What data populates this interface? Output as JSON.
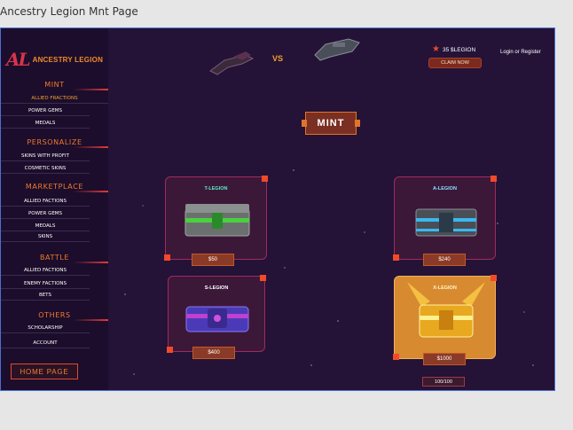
{
  "window": {
    "title": "Ancestry Legion Mnt Page"
  },
  "logo": {
    "mark": "AL",
    "text": "ANCESTRY LEGION"
  },
  "sidebar": {
    "sections": [
      {
        "title": "MINT",
        "items": [
          "ALLIED FRACTIONS",
          "POWER GEMS",
          "MEDALS"
        ]
      },
      {
        "title": "PERSONALIZE",
        "items": [
          "SKINS WITH PROFIT",
          "COSMETIC SKINS"
        ]
      },
      {
        "title": "MARKETPLACE",
        "items": [
          "ALLIED FACTIONS",
          "POWER GEMS",
          "MEDALS",
          "SKINS"
        ]
      },
      {
        "title": "BATTLE",
        "items": [
          "ALLIED FACTIONS",
          "ENEMY FACTIONS",
          "BETS"
        ]
      },
      {
        "title": "OTHERS",
        "items": [
          "SCHOLARSHIP",
          "ACCOUNT"
        ]
      }
    ],
    "home_button": "HOME PAGE"
  },
  "header": {
    "vs": "VS",
    "balance": "35 $LEGION",
    "claim_button": "CLAIM NOW",
    "login": "Login or Register"
  },
  "mint_banner": "MINT",
  "cards": [
    {
      "name": "T-LEGION",
      "price": "$50"
    },
    {
      "name": "A-LEGION",
      "price": "$240"
    },
    {
      "name": "S-LEGION",
      "price": "$400"
    },
    {
      "name": "X-LEGION",
      "price": "$1000"
    }
  ],
  "x_legion_count": "100/100",
  "colors": {
    "accent": "#f07a2a",
    "background": "#241237",
    "sidebar": "#1c0d2c"
  }
}
